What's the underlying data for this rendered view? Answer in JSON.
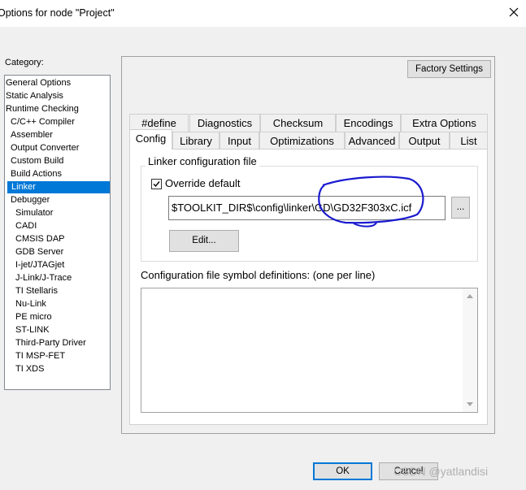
{
  "window": {
    "title": "Options for node \"Project\""
  },
  "category": {
    "label": "Category:",
    "items": [
      {
        "label": "General Options",
        "indent": 0,
        "selected": false
      },
      {
        "label": "Static Analysis",
        "indent": 0,
        "selected": false
      },
      {
        "label": "Runtime Checking",
        "indent": 0,
        "selected": false
      },
      {
        "label": "C/C++ Compiler",
        "indent": 1,
        "selected": false
      },
      {
        "label": "Assembler",
        "indent": 1,
        "selected": false
      },
      {
        "label": "Output Converter",
        "indent": 1,
        "selected": false
      },
      {
        "label": "Custom Build",
        "indent": 1,
        "selected": false
      },
      {
        "label": "Build Actions",
        "indent": 1,
        "selected": false
      },
      {
        "label": "Linker",
        "indent": 1,
        "selected": true
      },
      {
        "label": "Debugger",
        "indent": 1,
        "selected": false
      },
      {
        "label": "Simulator",
        "indent": 2,
        "selected": false
      },
      {
        "label": "CADI",
        "indent": 2,
        "selected": false
      },
      {
        "label": "CMSIS DAP",
        "indent": 2,
        "selected": false
      },
      {
        "label": "GDB Server",
        "indent": 2,
        "selected": false
      },
      {
        "label": "I-jet/JTAGjet",
        "indent": 2,
        "selected": false
      },
      {
        "label": "J-Link/J-Trace",
        "indent": 2,
        "selected": false
      },
      {
        "label": "TI Stellaris",
        "indent": 2,
        "selected": false
      },
      {
        "label": "Nu-Link",
        "indent": 2,
        "selected": false
      },
      {
        "label": "PE micro",
        "indent": 2,
        "selected": false
      },
      {
        "label": "ST-LINK",
        "indent": 2,
        "selected": false
      },
      {
        "label": "Third-Party Driver",
        "indent": 2,
        "selected": false
      },
      {
        "label": "TI MSP-FET",
        "indent": 2,
        "selected": false
      },
      {
        "label": "TI XDS",
        "indent": 2,
        "selected": false
      }
    ]
  },
  "factory_settings": "Factory Settings",
  "tabs_row1": [
    "#define",
    "Diagnostics",
    "Checksum",
    "Encodings",
    "Extra Options"
  ],
  "tabs_row2": [
    "Config",
    "Library",
    "Input",
    "Optimizations",
    "Advanced",
    "Output",
    "List"
  ],
  "active_tab": "Config",
  "linker_config": {
    "group_label": "Linker configuration file",
    "override_label": "Override default",
    "override_checked": true,
    "path": "$TOOLKIT_DIR$\\config\\linker\\GD\\GD32F303xC.icf",
    "browse_label": "...",
    "edit_label": "Edit..."
  },
  "symbol_defs": {
    "label": "Configuration file symbol definitions: (one per line)",
    "value": ""
  },
  "footer": {
    "ok": "OK",
    "cancel": "Cancel"
  },
  "watermark": "CSDN @yatlandisi",
  "annotation_color": "#1a1ad0"
}
